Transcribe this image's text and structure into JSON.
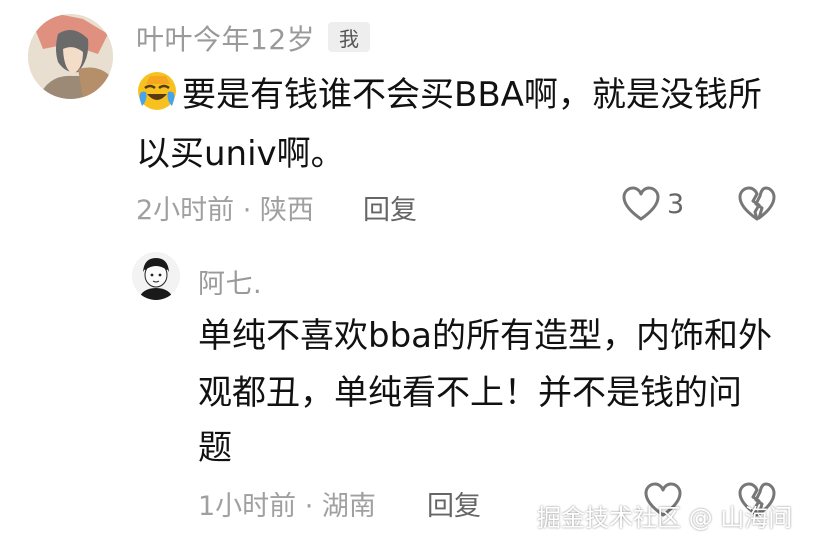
{
  "comment": {
    "username": "叶叶今年12岁",
    "badge": "我",
    "text": "要是有钱谁不会买BBA啊，就是没钱所以买univ啊。",
    "line1": "要是有钱谁不会买BBA啊，就是没钱所",
    "line2": "以买univ啊。",
    "meta": "2小时前 · 陕西",
    "reply_label": "回复",
    "like_count": "3",
    "emoji": "face-palm-emoji"
  },
  "reply": {
    "username": "阿七.",
    "line1": "单纯不喜欢bba的所有造型，内饰和外",
    "line2": "观都丑，单纯看不上！并不是钱的问",
    "line3": "题",
    "meta": "1小时前 · 湖南",
    "reply_label": "回复"
  },
  "watermark": "掘金技术社区 @ 山海间",
  "icons": {
    "like": "heart-icon",
    "dislike": "broken-heart-icon"
  },
  "colors": {
    "text": "#111111",
    "muted": "#a0a0a0",
    "badge_bg": "#eeeeee"
  }
}
